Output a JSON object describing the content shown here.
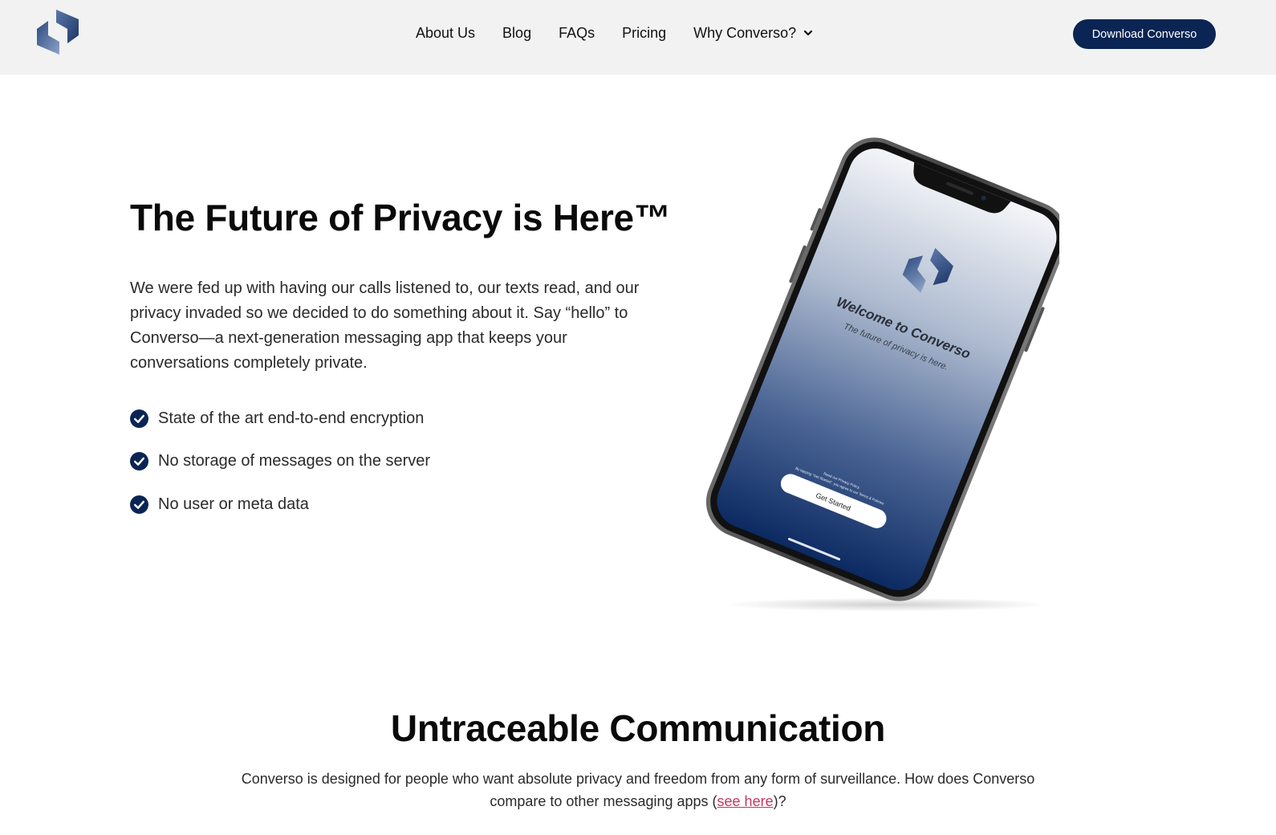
{
  "header": {
    "logo_icon": "converso-logo-icon",
    "nav": [
      {
        "label": "About Us"
      },
      {
        "label": "Blog"
      },
      {
        "label": "FAQs"
      },
      {
        "label": "Pricing"
      },
      {
        "label": "Why Converso?",
        "has_dropdown": true
      }
    ],
    "download_label": "Download Converso"
  },
  "hero": {
    "title": "The Future of Privacy is Here™",
    "description": "We were fed up with having our calls listened to, our texts read, and our privacy invaded so we decided to do something about it. Say “hello” to Converso—a next-generation messaging app that keeps your conversations completely private.",
    "features": [
      "State of the art end-to-end encryption",
      "No storage of messages on the server",
      "No user or meta data"
    ],
    "phone_screen": {
      "welcome": "Welcome to Converso",
      "tagline": "The future of privacy is here.",
      "legal_line1": "Read our Privacy Policy.",
      "legal_line2": "By tapping \"Get Started\", you agree to our Terms & Policies",
      "cta": "Get Started"
    }
  },
  "section2": {
    "title": "Untraceable Communication",
    "desc_before": "Converso is designed for people who want absolute privacy and freedom from any form of surveillance. How does Converso compare to other messaging apps (",
    "desc_link": "see here",
    "desc_after": ")?"
  },
  "colors": {
    "brand_navy": "#0a2553",
    "header_bg": "#f2f2f2",
    "link_pink": "#c0395e"
  }
}
